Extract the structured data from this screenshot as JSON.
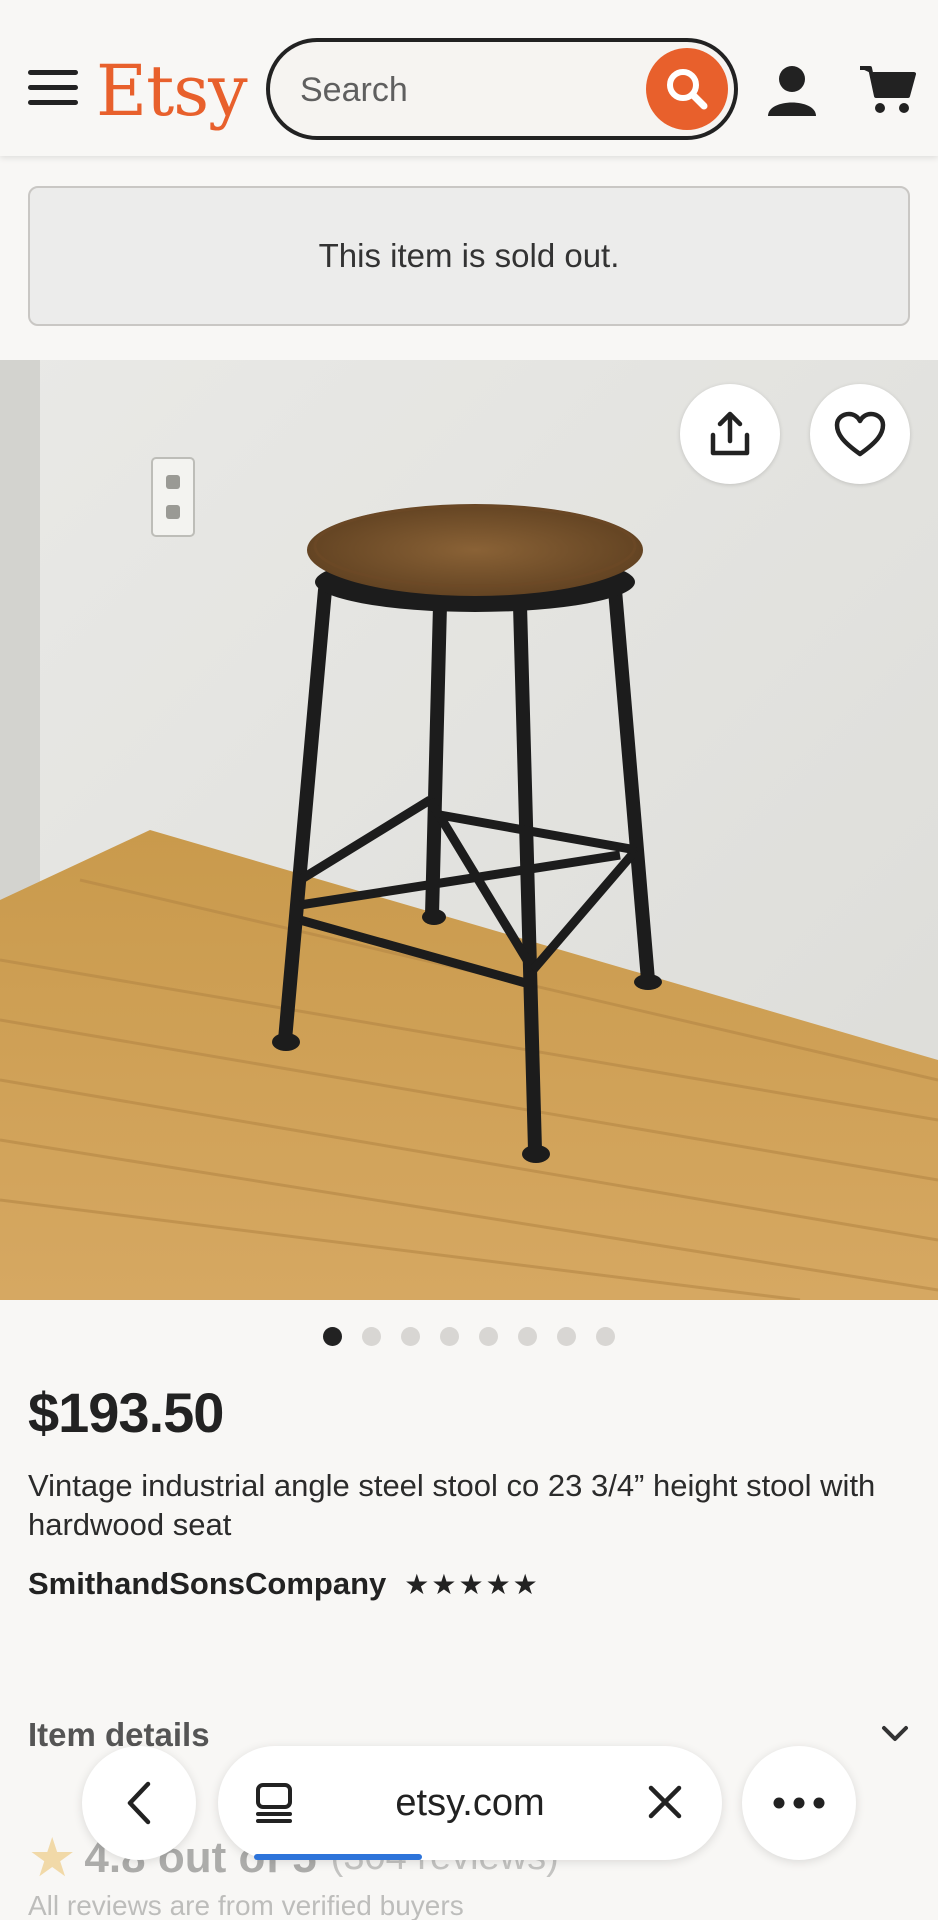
{
  "header": {
    "logo": "Etsy",
    "search_placeholder": "Search"
  },
  "listing": {
    "sold_out_text": "This item is sold out.",
    "image_count": 8,
    "active_image": 1,
    "price": "$193.50",
    "title": "Vintage industrial angle steel stool co 23 3/4” height stool with hardwood seat",
    "shop_name": "SmithandSonsCompany",
    "shop_stars": "★★★★★",
    "item_details_label": "Item details"
  },
  "reviews": {
    "star": "★",
    "rating_text": "4.8 out of 5",
    "count_text": "(304 reviews)",
    "verified_text": "All reviews are from verified buyers"
  },
  "browser": {
    "url": "etsy.com"
  },
  "colors": {
    "brand": "#e8602c",
    "background": "#f8f7f5",
    "progress": "#2d74da"
  }
}
